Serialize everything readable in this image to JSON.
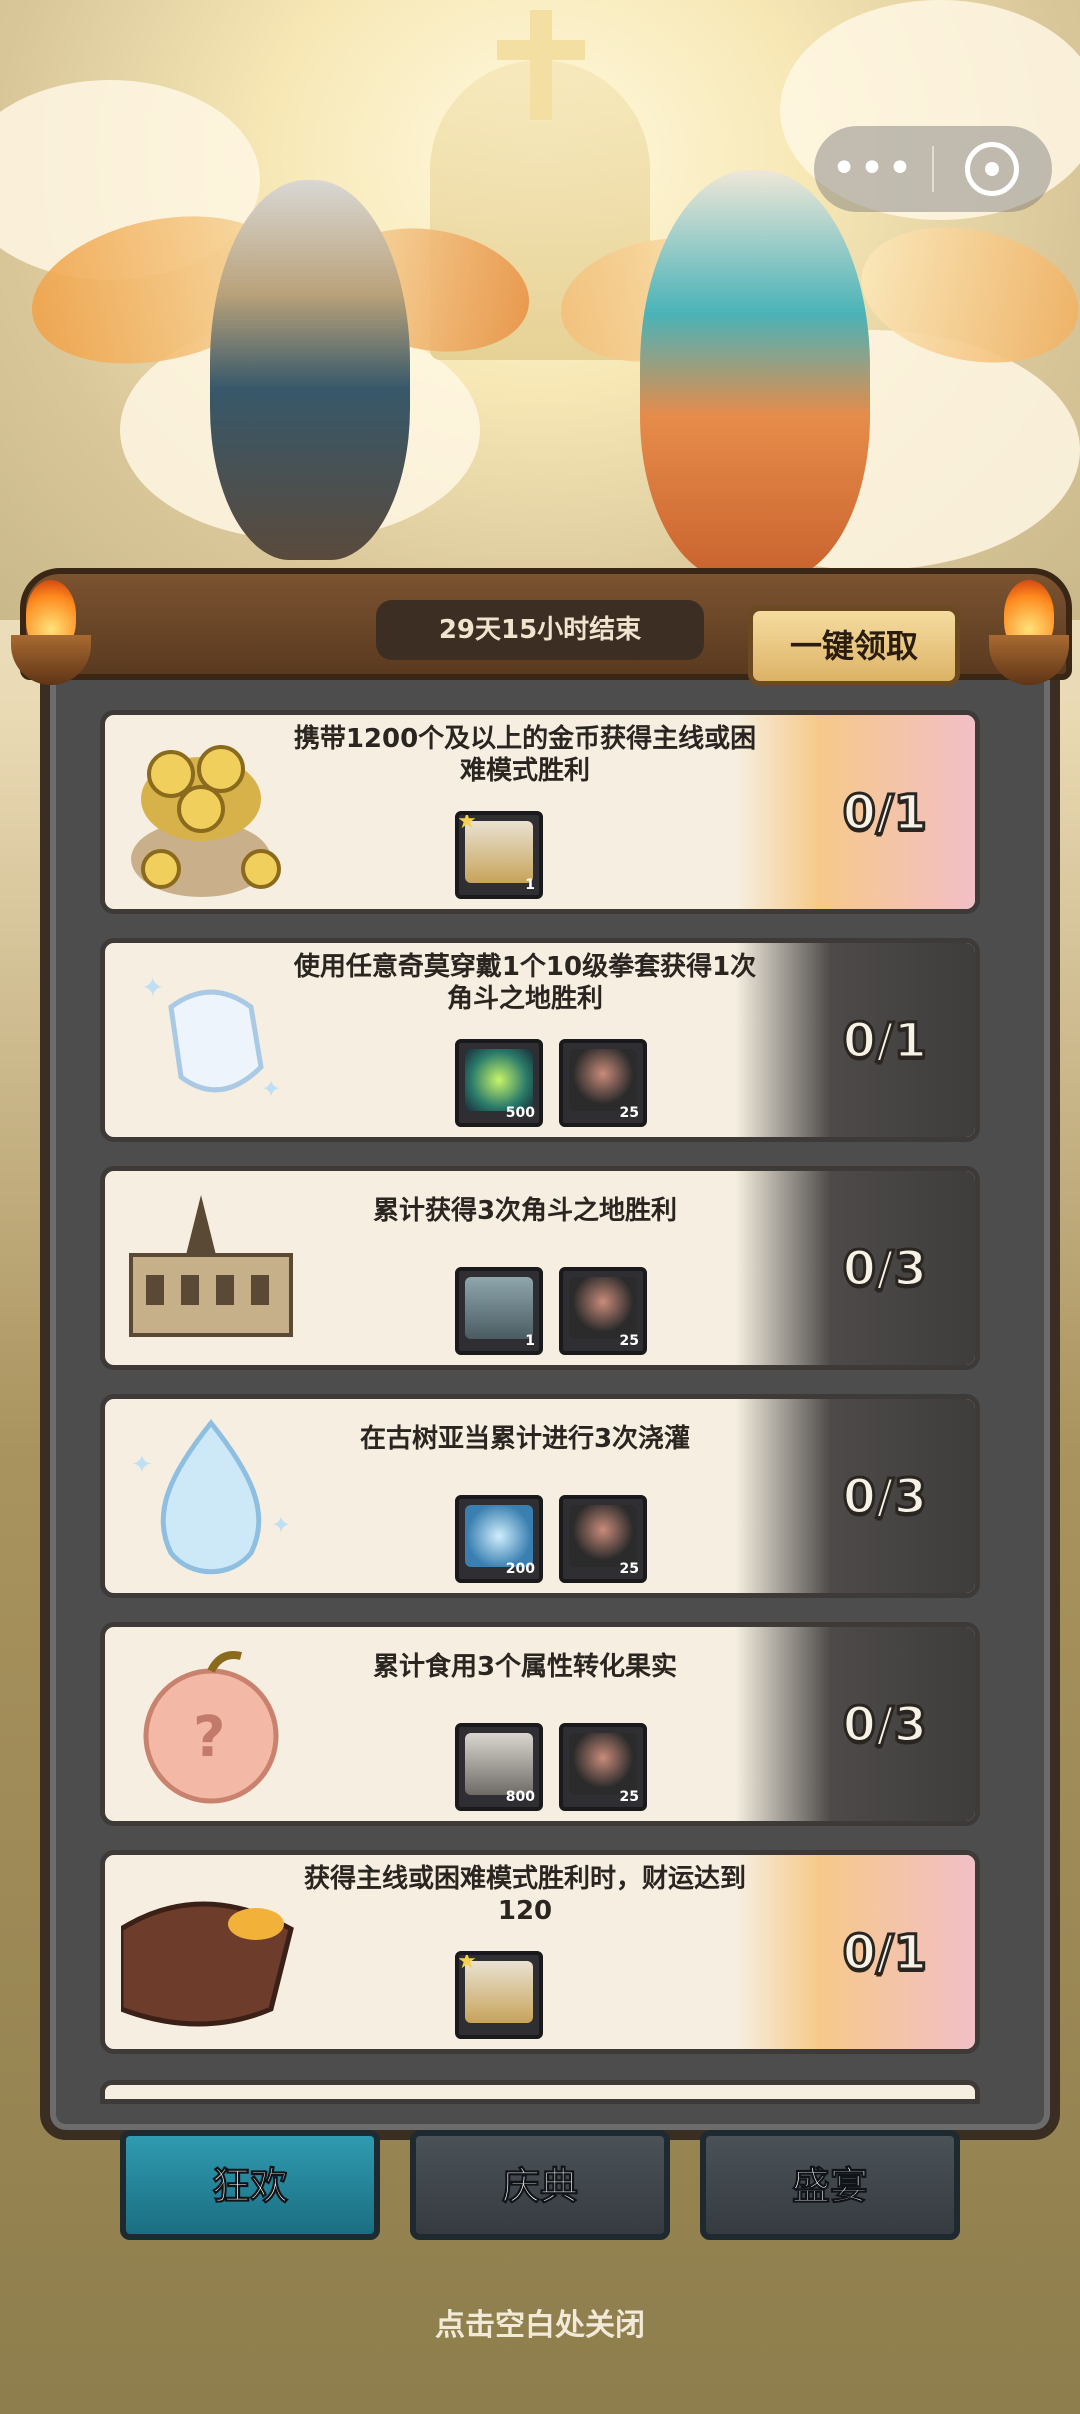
{
  "header": {
    "capsule": {
      "more_icon": "more-dots-icon",
      "close_icon": "target-icon"
    }
  },
  "board": {
    "timer_text": "29天15小时结束",
    "claim_all_label": "一键领取"
  },
  "tasks": [
    {
      "title": "携带1200个及以上的金币获得主线或困难模式胜利",
      "progress": "0/1",
      "status": "done",
      "icon": "gold-coin-bag-icon",
      "rewards": [
        {
          "icon": "hero-portrait-icon",
          "qty": "1",
          "starred": true
        }
      ]
    },
    {
      "title": "使用任意奇莫穿戴1个10级拳套获得1次角斗之地胜利",
      "progress": "0/1",
      "status": "todo",
      "icon": "gauntlet-icon",
      "rewards": [
        {
          "icon": "sparkle-star-icon",
          "qty": "500",
          "starred": false
        },
        {
          "icon": "pig-warrior-icon",
          "qty": "25",
          "starred": false
        }
      ]
    },
    {
      "title": "累计获得3次角斗之地胜利",
      "progress": "0/3",
      "status": "todo",
      "icon": "colosseum-icon",
      "rewards": [
        {
          "icon": "treasure-chest-icon",
          "qty": "1",
          "starred": false
        },
        {
          "icon": "pig-warrior-icon",
          "qty": "25",
          "starred": false
        }
      ]
    },
    {
      "title": "在古树亚当累计进行3次浇灌",
      "progress": "0/3",
      "status": "todo",
      "icon": "water-drop-crystal-icon",
      "rewards": [
        {
          "icon": "water-drop-icon",
          "qty": "200",
          "starred": false
        },
        {
          "icon": "pig-warrior-icon",
          "qty": "25",
          "starred": false
        }
      ]
    },
    {
      "title": "累计食用3个属性转化果实",
      "progress": "0/3",
      "status": "todo",
      "icon": "mystery-fruit-icon",
      "rewards": [
        {
          "icon": "potion-vial-icon",
          "qty": "800",
          "starred": false
        },
        {
          "icon": "pig-warrior-icon",
          "qty": "25",
          "starred": false
        }
      ]
    },
    {
      "title": "获得主线或困难模式胜利时，财运达到120",
      "progress": "0/1",
      "status": "done",
      "icon": "dragon-head-icon",
      "rewards": [
        {
          "icon": "hero-portrait-icon",
          "qty": "",
          "starred": true
        }
      ]
    }
  ],
  "tabs": [
    {
      "label": "狂欢",
      "active": true
    },
    {
      "label": "庆典",
      "active": false
    },
    {
      "label": "盛宴",
      "active": false
    }
  ],
  "footer": {
    "close_hint": "点击空白处关闭"
  },
  "colors": {
    "tab_active": "#1b6e82",
    "tab_inactive": "#353b40",
    "card_bg": "#f6efe1",
    "claim_button": "#dcb366"
  }
}
